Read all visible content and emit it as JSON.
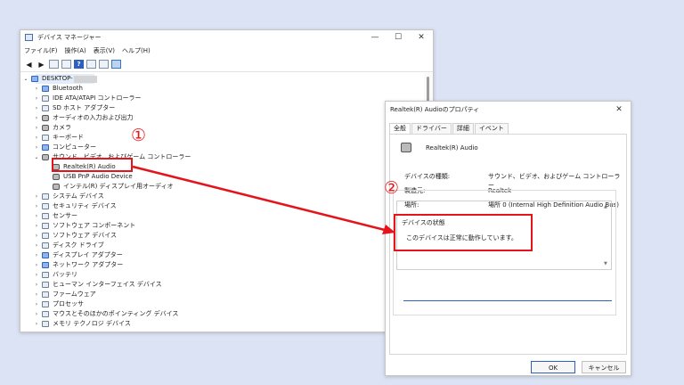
{
  "device_manager": {
    "title": "デバイス マネージャー",
    "caption": {
      "minimize": "—",
      "maximize": "☐",
      "close": "✕"
    },
    "menu": [
      "ファイル(F)",
      "操作(A)",
      "表示(V)",
      "ヘルプ(H)"
    ],
    "toolbar_help_glyph": "?",
    "root": "DESKTOP-",
    "categories": [
      "Bluetooth",
      "IDE ATA/ATAPI コントローラー",
      "SD ホスト アダプター",
      "オーディオの入力および出力",
      "カメラ",
      "キーボード",
      "コンピューター",
      "サウンド、ビデオ、およびゲーム コントローラー",
      "システム デバイス",
      "セキュリティ デバイス",
      "センサー",
      "ソフトウェア コンポーネント",
      "ソフトウェア デバイス",
      "ディスク ドライブ",
      "ディスプレイ アダプター",
      "ネットワーク アダプター",
      "バッテリ",
      "ヒューマン インターフェイス デバイス",
      "ファームウェア",
      "プロセッサ",
      "マウスとそのほかのポインティング デバイス",
      "メモリ テクノロジ デバイス"
    ],
    "sound_children": [
      "Realtek(R) Audio",
      "USB PnP Audio Device",
      "インテル(R) ディスプレイ用オーディオ"
    ]
  },
  "properties": {
    "title": "Realtek(R) Audioのプロパティ",
    "close": "✕",
    "tabs": [
      "全般",
      "ドライバー",
      "詳細",
      "イベント"
    ],
    "device_name": "Realtek(R) Audio",
    "rows": [
      {
        "label": "デバイスの種類:",
        "value": "サウンド、ビデオ、およびゲーム コントローラー"
      },
      {
        "label": "製造元:",
        "value": "Realtek"
      },
      {
        "label": "場所:",
        "value": "場所 0 (Internal High Definition Audio Bus)"
      }
    ],
    "status_group_label": "デバイスの状態",
    "status_text": "このデバイスは正常に動作しています。",
    "ok": "OK",
    "cancel": "キャンセル"
  },
  "annotations": {
    "one": "①",
    "two": "②"
  },
  "colors": {
    "annotation_red": "#e5141a",
    "accent_blue": "#2c5fc0",
    "background": "#dbe3f4"
  }
}
